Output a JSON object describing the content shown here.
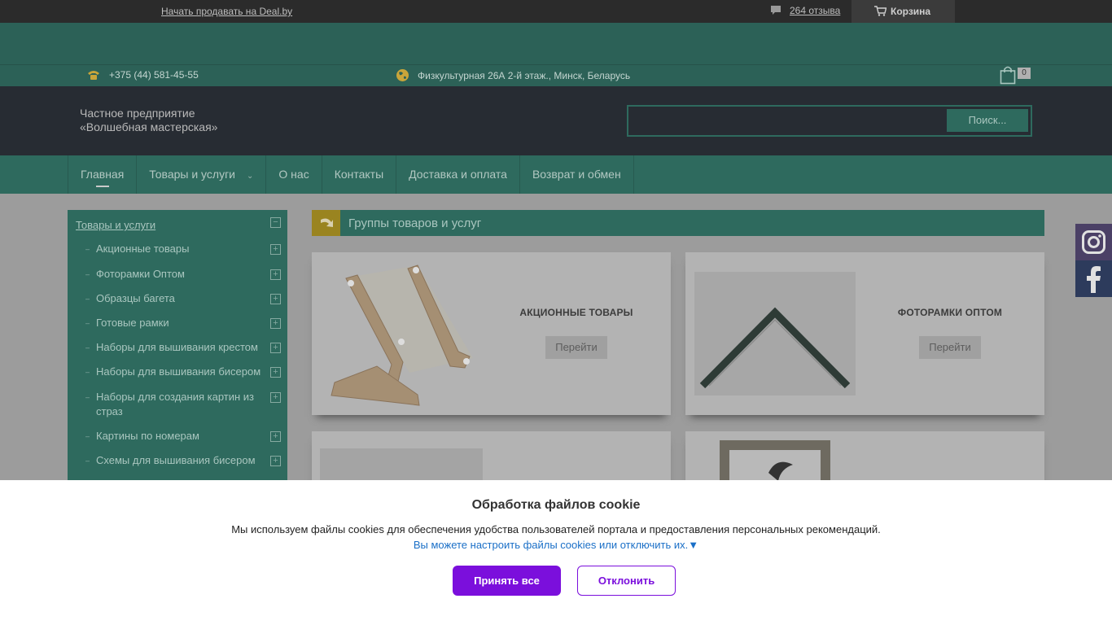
{
  "topbar": {
    "sell_link": "Начать продавать на Deal.by",
    "reviews_link": "264 отзыва",
    "cart_label": "Корзина"
  },
  "contacts": {
    "phone": "+375 (44) 581-45-55",
    "address": "Физкультурная 26А 2-й этаж., Минск, Беларусь",
    "cart_count": "0"
  },
  "header": {
    "company_line1": "Частное предприятие",
    "company_line2": "«Волшебная мастерская»",
    "search_placeholder": "",
    "search_button": "Поиск..."
  },
  "nav": {
    "items": [
      {
        "label": "Главная"
      },
      {
        "label": "Товары и услуги"
      },
      {
        "label": "О нас"
      },
      {
        "label": "Контакты"
      },
      {
        "label": "Доставка и оплата"
      },
      {
        "label": "Возврат и обмен"
      }
    ]
  },
  "sidebar": {
    "heading": "Товары и услуги",
    "items": [
      {
        "label": "Акционные товары"
      },
      {
        "label": "Фоторамки Оптом"
      },
      {
        "label": "Образцы багета"
      },
      {
        "label": "Готовые рамки"
      },
      {
        "label": "Наборы для вышивания крестом"
      },
      {
        "label": "Наборы для вышивания бисером"
      },
      {
        "label": "Наборы для создания картин из страз"
      },
      {
        "label": "Картины по номерам"
      },
      {
        "label": "Схемы для вышивания бисером"
      }
    ]
  },
  "content": {
    "title": "Группы товаров и услуг",
    "cards": [
      {
        "title": "АКЦИОННЫЕ ТОВАРЫ",
        "button": "Перейти"
      },
      {
        "title": "ФОТОРАМКИ ОПТОМ",
        "button": "Перейти"
      }
    ]
  },
  "cookie": {
    "heading": "Обработка файлов cookie",
    "text": "Мы используем файлы cookies для обеспечения удобства пользователей портала и предоставления персональных рекомендаций.",
    "settings_link": "Вы можете настроить файлы cookies или отключить их.▼",
    "accept": "Принять все",
    "decline": "Отклонить"
  },
  "colors": {
    "accent_purple": "#7b0fdc",
    "brand_green": "#2e6a5e",
    "header_dark": "#272c33"
  }
}
